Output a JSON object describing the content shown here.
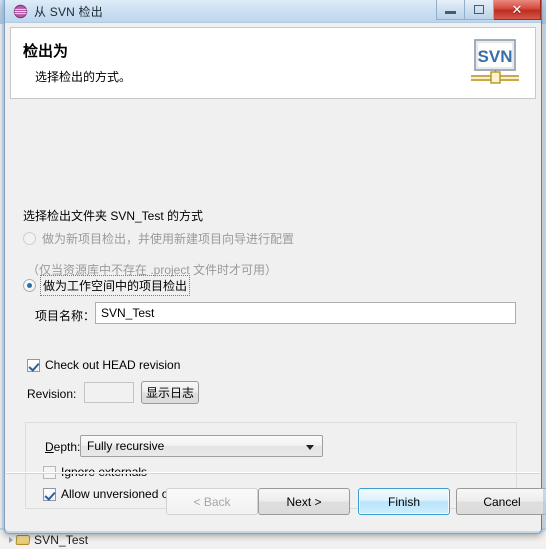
{
  "window": {
    "title": "从 SVN 检出",
    "title_icon": "svn-repository-icon",
    "minimize_label": "最小化",
    "maximize_label": "还原",
    "close_label": "✕"
  },
  "header": {
    "title": "检出为",
    "subtitle": "选择检出的方式。",
    "logo_text": "SVN",
    "logo_name": "svn-banner-logo"
  },
  "main": {
    "section_label": "选择检出文件夹 SVN_Test 的方式",
    "option_new_project": {
      "label": "做为新项目检出，并使用新建项目向导进行配置",
      "hint": "（仅当资源库中不存在 .project 文件时才可用）",
      "checked": false,
      "enabled": false
    },
    "option_workspace_project": {
      "label": "做为工作空间中的项目检出",
      "checked": true,
      "enabled": true,
      "focused": true
    },
    "project_name": {
      "label": "项目名称：",
      "value": "SVN_Test",
      "placeholder": ""
    },
    "head_revision": {
      "label": "Check out HEAD revision",
      "checked": true
    },
    "revision": {
      "label": "Revision:",
      "value": "",
      "placeholder": "",
      "enabled": false
    },
    "show_log_button": "显示日志",
    "depth_group": {
      "depth_label": "Depth:",
      "depth_label_mnemonic": "D",
      "depth_value": "Fully recursive",
      "depth_options": [
        "Fully recursive"
      ],
      "ignore_externals": {
        "label": "Ignore externals",
        "mnemonic": "I",
        "checked": false
      },
      "allow_unversioned": {
        "label": "Allow unversioned obstructions",
        "mnemonic": "A",
        "checked": true
      }
    }
  },
  "buttons": {
    "back": "< Back",
    "back_enabled": false,
    "next": "Next >",
    "finish": "Finish",
    "finish_default": true,
    "cancel": "Cancel"
  },
  "background": {
    "tree_item_label": "SVN_Test"
  },
  "colors": {
    "accent": "#3c9fd4",
    "titlebar": "#c6ddf2",
    "dialog_bg": "#f0f0f0",
    "close_button": "#d44a3d",
    "radio_dot": "#2a6fb0",
    "disabled_text": "#9a9a9a"
  }
}
